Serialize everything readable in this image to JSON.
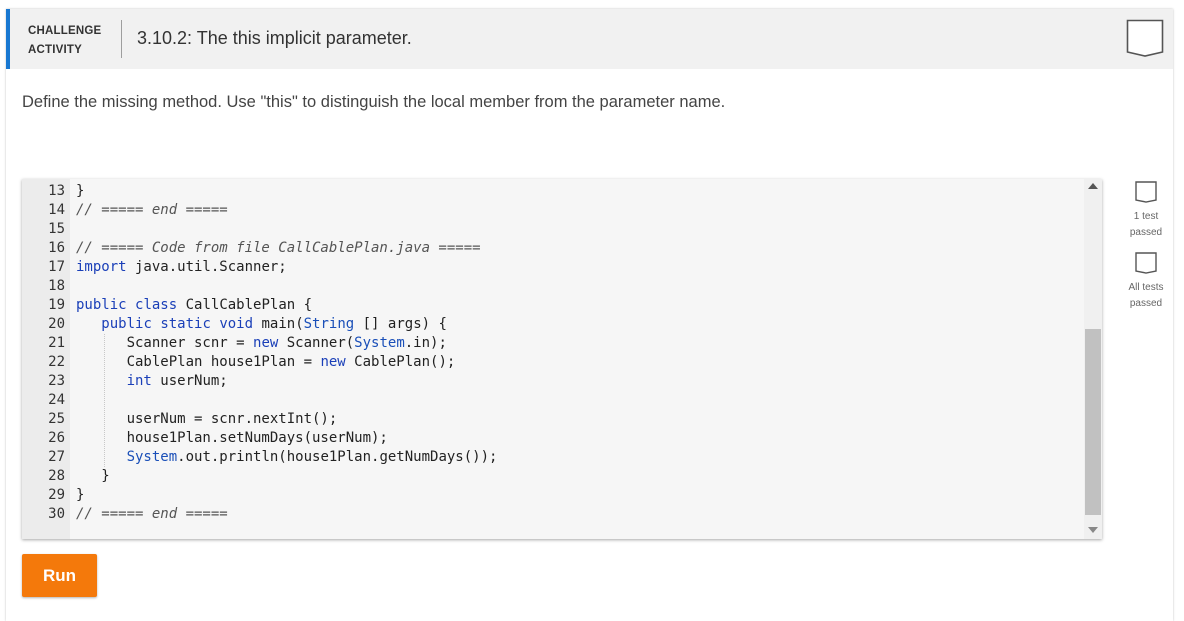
{
  "header": {
    "label_line1": "CHALLENGE",
    "label_line2": "ACTIVITY",
    "title": "3.10.2: The this implicit parameter."
  },
  "instructions": "Define the missing method. Use \"this\" to distinguish the local member from the parameter name.",
  "code_lines": [
    {
      "num": "13",
      "text": "}"
    },
    {
      "num": "14",
      "text": "// ===== end ====="
    },
    {
      "num": "15",
      "text": ""
    },
    {
      "num": "16",
      "text": "// ===== Code from file CallCablePlan.java ====="
    },
    {
      "num": "17",
      "text": "import java.util.Scanner;"
    },
    {
      "num": "18",
      "text": ""
    },
    {
      "num": "19",
      "text": "public class CallCablePlan {"
    },
    {
      "num": "20",
      "text": "   public static void main(String [] args) {"
    },
    {
      "num": "21",
      "text": "      Scanner scnr = new Scanner(System.in);"
    },
    {
      "num": "22",
      "text": "      CablePlan house1Plan = new CablePlan();"
    },
    {
      "num": "23",
      "text": "      int userNum;"
    },
    {
      "num": "24",
      "text": ""
    },
    {
      "num": "25",
      "text": "      userNum = scnr.nextInt();"
    },
    {
      "num": "26",
      "text": "      house1Plan.setNumDays(userNum);"
    },
    {
      "num": "27",
      "text": "      System.out.println(house1Plan.getNumDays());"
    },
    {
      "num": "28",
      "text": "   }"
    },
    {
      "num": "29",
      "text": "}"
    },
    {
      "num": "30",
      "text": "// ===== end ====="
    }
  ],
  "run_label": "Run",
  "side": {
    "test1_line1": "1 test",
    "test1_line2": "passed",
    "test2_line1": "All tests",
    "test2_line2": "passed"
  },
  "colors": {
    "accent": "#1877d1",
    "run_button": "#f4790b",
    "keyword": "#1a3fb8"
  },
  "icons": {
    "status": "badge-outline-icon",
    "test": "badge-outline-icon",
    "scroll_up": "triangle-up-icon",
    "scroll_down": "triangle-down-icon"
  }
}
